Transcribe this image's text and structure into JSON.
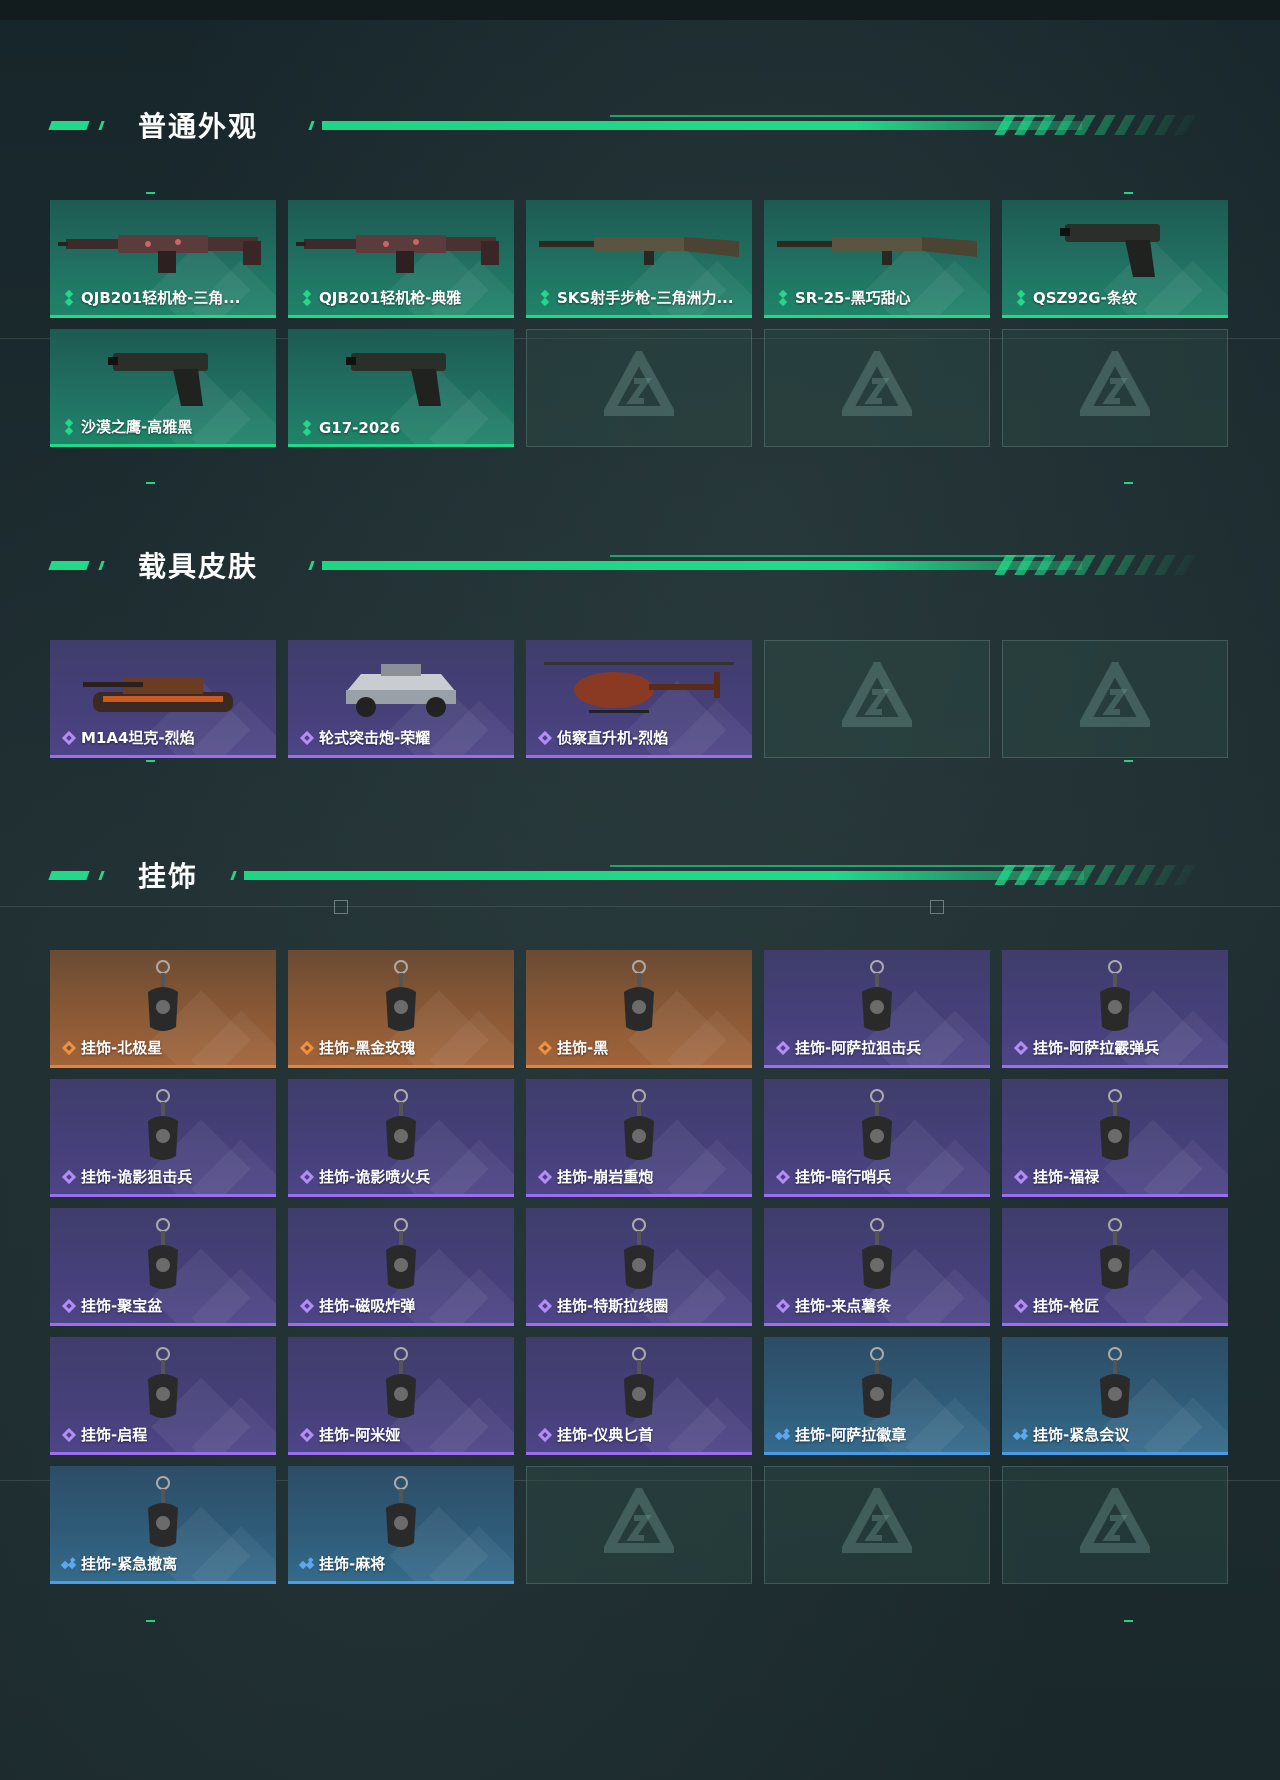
{
  "sections": [
    {
      "title": "普通外观",
      "items": [
        {
          "label": "QJB201轻机枪-三角...",
          "rarity": "green",
          "icon": "machine-gun-icon"
        },
        {
          "label": "QJB201轻机枪-典雅",
          "rarity": "green",
          "icon": "machine-gun-icon"
        },
        {
          "label": "SKS射手步枪-三角洲力...",
          "rarity": "green",
          "icon": "rifle-icon"
        },
        {
          "label": "SR-25-黑巧甜心",
          "rarity": "green",
          "icon": "rifle-icon"
        },
        {
          "label": "QSZ92G-条纹",
          "rarity": "green",
          "icon": "pistol-icon"
        },
        {
          "label": "沙漠之鹰-高雅黑",
          "rarity": "green",
          "icon": "pistol-icon"
        },
        {
          "label": "G17-2026",
          "rarity": "green",
          "icon": "pistol-icon"
        },
        {
          "label": "",
          "rarity": "empty"
        },
        {
          "label": "",
          "rarity": "empty"
        },
        {
          "label": "",
          "rarity": "empty"
        }
      ]
    },
    {
      "title": "载具皮肤",
      "items": [
        {
          "label": "M1A4坦克-烈焰",
          "rarity": "purple",
          "icon": "tank-icon"
        },
        {
          "label": "轮式突击炮-荣耀",
          "rarity": "purple",
          "icon": "armored-car-icon"
        },
        {
          "label": "侦察直升机-烈焰",
          "rarity": "purple",
          "icon": "helicopter-icon"
        },
        {
          "label": "",
          "rarity": "empty"
        },
        {
          "label": "",
          "rarity": "empty"
        }
      ]
    },
    {
      "title": "挂饰",
      "items": [
        {
          "label": "挂饰-北极星",
          "rarity": "orange",
          "icon": "charm-icon"
        },
        {
          "label": "挂饰-黑金玫瑰",
          "rarity": "orange",
          "icon": "charm-icon"
        },
        {
          "label": "挂饰-黑",
          "rarity": "orange",
          "icon": "charm-icon"
        },
        {
          "label": "挂饰-阿萨拉狙击兵",
          "rarity": "purple",
          "icon": "charm-icon"
        },
        {
          "label": "挂饰-阿萨拉霰弹兵",
          "rarity": "purple",
          "icon": "charm-icon"
        },
        {
          "label": "挂饰-诡影狙击兵",
          "rarity": "purple",
          "icon": "charm-icon"
        },
        {
          "label": "挂饰-诡影喷火兵",
          "rarity": "purple",
          "icon": "charm-icon"
        },
        {
          "label": "挂饰-崩岩重炮",
          "rarity": "purple",
          "icon": "charm-icon"
        },
        {
          "label": "挂饰-暗行哨兵",
          "rarity": "purple",
          "icon": "charm-icon"
        },
        {
          "label": "挂饰-福禄",
          "rarity": "purple",
          "icon": "charm-icon"
        },
        {
          "label": "挂饰-聚宝盆",
          "rarity": "purple",
          "icon": "charm-icon"
        },
        {
          "label": "挂饰-磁吸炸弹",
          "rarity": "purple",
          "icon": "charm-icon"
        },
        {
          "label": "挂饰-特斯拉线圈",
          "rarity": "purple",
          "icon": "charm-icon"
        },
        {
          "label": "挂饰-来点薯条",
          "rarity": "purple",
          "icon": "charm-icon"
        },
        {
          "label": "挂饰-枪匠",
          "rarity": "purple",
          "icon": "charm-icon"
        },
        {
          "label": "挂饰-启程",
          "rarity": "purple",
          "icon": "charm-icon"
        },
        {
          "label": "挂饰-阿米娅",
          "rarity": "purple",
          "icon": "charm-icon"
        },
        {
          "label": "挂饰-仪典匕首",
          "rarity": "purple",
          "icon": "charm-icon"
        },
        {
          "label": "挂饰-阿萨拉徽章",
          "rarity": "blue",
          "icon": "charm-icon"
        },
        {
          "label": "挂饰-紧急会议",
          "rarity": "blue",
          "icon": "charm-icon"
        },
        {
          "label": "挂饰-紧急撤离",
          "rarity": "blue",
          "icon": "charm-icon"
        },
        {
          "label": "挂饰-麻将",
          "rarity": "blue",
          "icon": "charm-icon"
        },
        {
          "label": "",
          "rarity": "empty"
        },
        {
          "label": "",
          "rarity": "empty"
        },
        {
          "label": "",
          "rarity": "empty"
        }
      ]
    }
  ],
  "colors": {
    "accent": "#22d98a",
    "green": "#22d98a",
    "purple": "#9b6ef0",
    "orange": "#e6833a",
    "blue": "#4c9be6"
  }
}
